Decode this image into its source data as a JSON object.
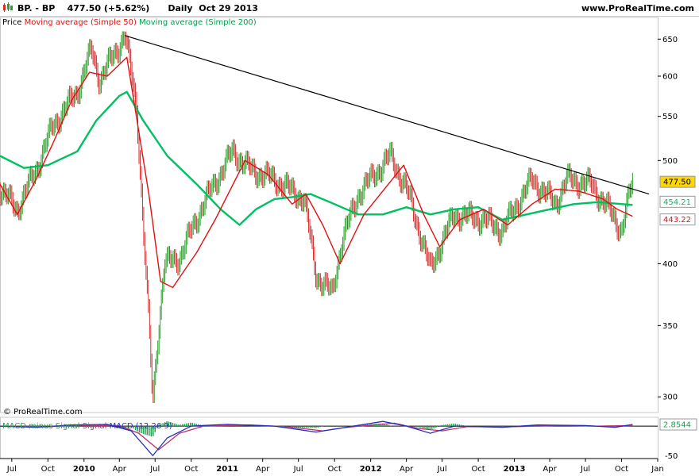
{
  "header": {
    "ticker": "BP. - BP",
    "last": "477.50 (+5.62%)",
    "period": "Daily",
    "date": "Oct 29 2013",
    "site": "www.ProRealTime.com",
    "logo_icon": "candlestick-logo-icon"
  },
  "legend": {
    "price": "Price",
    "ma50": "Moving average (Simple 50)",
    "ma200": "Moving average (Simple 200)"
  },
  "copyright": "© ProRealTime.com",
  "macd_legend": {
    "label1": "MACD minus Signal",
    "label2": "Signal",
    "label3": "MACD (12 26 9)"
  },
  "colors": {
    "ma50": "#e01010",
    "ma200": "#00c060",
    "up": "#2ca02c",
    "down": "#d03030",
    "trend": "#000000",
    "macd": "#2030c0",
    "signal": "#c03070",
    "hist": "#20a050",
    "last_badge": "#ffd700"
  },
  "chart_data": [
    {
      "type": "line",
      "title": "",
      "yscale": "log",
      "ylim": [
        290,
        665
      ],
      "yticks": [
        "650",
        "600",
        "550",
        "500",
        "400",
        "350",
        "300"
      ],
      "xticks": [
        "Jul",
        "Oct",
        "2010",
        "Apr",
        "Jul",
        "Oct",
        "2011",
        "Apr",
        "Jul",
        "Oct",
        "2012",
        "Apr",
        "Jul",
        "Oct",
        "2013",
        "Apr",
        "Jul",
        "Oct",
        "Jan"
      ],
      "x_major": [
        "2010",
        "2011",
        "2012",
        "2013"
      ],
      "x_start": "2009-06-01",
      "x_end": "2014-01-01",
      "series": [
        {
          "name": "Price",
          "points": [
            [
              "2009-06-01",
              470
            ],
            [
              "2009-07-15",
              450
            ],
            [
              "2009-09-01",
              490
            ],
            [
              "2009-10-15",
              540
            ],
            [
              "2009-12-15",
              580
            ],
            [
              "2010-01-20",
              635
            ],
            [
              "2010-02-10",
              595
            ],
            [
              "2010-04-15",
              655
            ],
            [
              "2010-05-15",
              560
            ],
            [
              "2010-06-01",
              430
            ],
            [
              "2010-06-25",
              296
            ],
            [
              "2010-07-25",
              400
            ],
            [
              "2010-09-01",
              405
            ],
            [
              "2010-11-01",
              455
            ],
            [
              "2011-01-15",
              510
            ],
            [
              "2011-03-01",
              490
            ],
            [
              "2011-05-01",
              480
            ],
            [
              "2011-07-15",
              460
            ],
            [
              "2011-08-15",
              390
            ],
            [
              "2011-09-25",
              375
            ],
            [
              "2011-10-20",
              420
            ],
            [
              "2011-12-01",
              465
            ],
            [
              "2012-02-20",
              505
            ],
            [
              "2012-04-01",
              470
            ],
            [
              "2012-06-01",
              395
            ],
            [
              "2012-08-01",
              445
            ],
            [
              "2012-10-15",
              440
            ],
            [
              "2012-12-01",
              430
            ],
            [
              "2013-02-15",
              480
            ],
            [
              "2013-04-15",
              455
            ],
            [
              "2013-05-15",
              480
            ],
            [
              "2013-07-15",
              475
            ],
            [
              "2013-08-20",
              455
            ],
            [
              "2013-10-01",
              430
            ],
            [
              "2013-10-29",
              477.5
            ]
          ]
        },
        {
          "name": "Moving average (Simple 50)",
          "points": [
            [
              "2009-06-01",
              475
            ],
            [
              "2009-07-15",
              445
            ],
            [
              "2009-09-01",
              480
            ],
            [
              "2009-10-15",
              520
            ],
            [
              "2009-12-01",
              570
            ],
            [
              "2010-01-15",
              605
            ],
            [
              "2010-03-01",
              600
            ],
            [
              "2010-04-20",
              625
            ],
            [
              "2010-05-01",
              590
            ],
            [
              "2010-06-15",
              465
            ],
            [
              "2010-07-15",
              385
            ],
            [
              "2010-08-15",
              380
            ],
            [
              "2010-10-15",
              410
            ],
            [
              "2010-12-01",
              440
            ],
            [
              "2011-02-15",
              500
            ],
            [
              "2011-04-15",
              485
            ],
            [
              "2011-06-15",
              455
            ],
            [
              "2011-07-20",
              465
            ],
            [
              "2011-09-01",
              435
            ],
            [
              "2011-10-15",
              400
            ],
            [
              "2011-12-15",
              445
            ],
            [
              "2012-02-15",
              475
            ],
            [
              "2012-03-25",
              495
            ],
            [
              "2012-05-15",
              445
            ],
            [
              "2012-06-25",
              415
            ],
            [
              "2012-08-15",
              440
            ],
            [
              "2012-10-15",
              450
            ],
            [
              "2012-12-15",
              435
            ],
            [
              "2013-02-15",
              455
            ],
            [
              "2013-04-15",
              470
            ],
            [
              "2013-06-15",
              468
            ],
            [
              "2013-08-15",
              460
            ],
            [
              "2013-09-20",
              450
            ],
            [
              "2013-10-29",
              443.22
            ]
          ]
        },
        {
          "name": "Moving average (Simple 200)",
          "points": [
            [
              "2009-06-01",
              505
            ],
            [
              "2009-08-01",
              492
            ],
            [
              "2009-10-01",
              495
            ],
            [
              "2009-12-15",
              510
            ],
            [
              "2010-02-01",
              545
            ],
            [
              "2010-04-01",
              575
            ],
            [
              "2010-04-20",
              580
            ],
            [
              "2010-06-01",
              545
            ],
            [
              "2010-08-01",
              505
            ],
            [
              "2010-10-15",
              475
            ],
            [
              "2010-12-15",
              450
            ],
            [
              "2011-02-01",
              435
            ],
            [
              "2011-03-15",
              450
            ],
            [
              "2011-05-01",
              460
            ],
            [
              "2011-06-15",
              462
            ],
            [
              "2011-08-01",
              465
            ],
            [
              "2011-10-01",
              455
            ],
            [
              "2011-12-01",
              445
            ],
            [
              "2012-02-01",
              445
            ],
            [
              "2012-04-01",
              452
            ],
            [
              "2012-06-01",
              445
            ],
            [
              "2012-08-01",
              450
            ],
            [
              "2012-10-01",
              452
            ],
            [
              "2012-12-01",
              440
            ],
            [
              "2013-02-01",
              445
            ],
            [
              "2013-04-01",
              450
            ],
            [
              "2013-06-01",
              455
            ],
            [
              "2013-08-01",
              457
            ],
            [
              "2013-10-29",
              454.21
            ]
          ]
        },
        {
          "name": "trendline",
          "points": [
            [
              "2010-04-15",
              655
            ],
            [
              "2013-12-10",
              465
            ]
          ]
        }
      ],
      "last_labels": [
        "477.50",
        "454.21",
        "443.22"
      ]
    },
    {
      "type": "line",
      "title": "MACD (12 26 9)",
      "ylim": [
        -55,
        15
      ],
      "yticks": [
        "-50"
      ],
      "last_value": "2.8544",
      "series": [
        {
          "name": "MACD",
          "points": [
            [
              "2009-06-01",
              0
            ],
            [
              "2009-09-01",
              -2
            ],
            [
              "2009-12-01",
              2
            ],
            [
              "2010-03-01",
              3
            ],
            [
              "2010-05-01",
              -8
            ],
            [
              "2010-06-25",
              -50
            ],
            [
              "2010-08-01",
              -20
            ],
            [
              "2010-10-01",
              0
            ],
            [
              "2011-01-01",
              3
            ],
            [
              "2011-05-01",
              0
            ],
            [
              "2011-08-15",
              -10
            ],
            [
              "2011-10-01",
              -5
            ],
            [
              "2012-02-01",
              8
            ],
            [
              "2012-04-01",
              0
            ],
            [
              "2012-06-01",
              -12
            ],
            [
              "2012-08-01",
              0
            ],
            [
              "2012-12-01",
              -2
            ],
            [
              "2013-03-01",
              2
            ],
            [
              "2013-07-01",
              1
            ],
            [
              "2013-09-15",
              -2
            ],
            [
              "2013-10-29",
              2.8544
            ]
          ]
        },
        {
          "name": "Signal",
          "points": [
            [
              "2009-06-01",
              0
            ],
            [
              "2009-10-01",
              -1
            ],
            [
              "2010-01-01",
              2
            ],
            [
              "2010-04-01",
              1
            ],
            [
              "2010-05-20",
              -12
            ],
            [
              "2010-07-10",
              -40
            ],
            [
              "2010-09-01",
              -12
            ],
            [
              "2010-11-01",
              0
            ],
            [
              "2011-03-01",
              2
            ],
            [
              "2011-06-01",
              -1
            ],
            [
              "2011-09-01",
              -8
            ],
            [
              "2011-11-01",
              -2
            ],
            [
              "2012-03-01",
              5
            ],
            [
              "2012-05-01",
              -4
            ],
            [
              "2012-07-01",
              -8
            ],
            [
              "2012-09-01",
              -1
            ],
            [
              "2013-01-01",
              -1
            ],
            [
              "2013-05-01",
              1
            ],
            [
              "2013-08-01",
              0
            ],
            [
              "2013-10-29",
              1
            ]
          ]
        }
      ]
    }
  ]
}
